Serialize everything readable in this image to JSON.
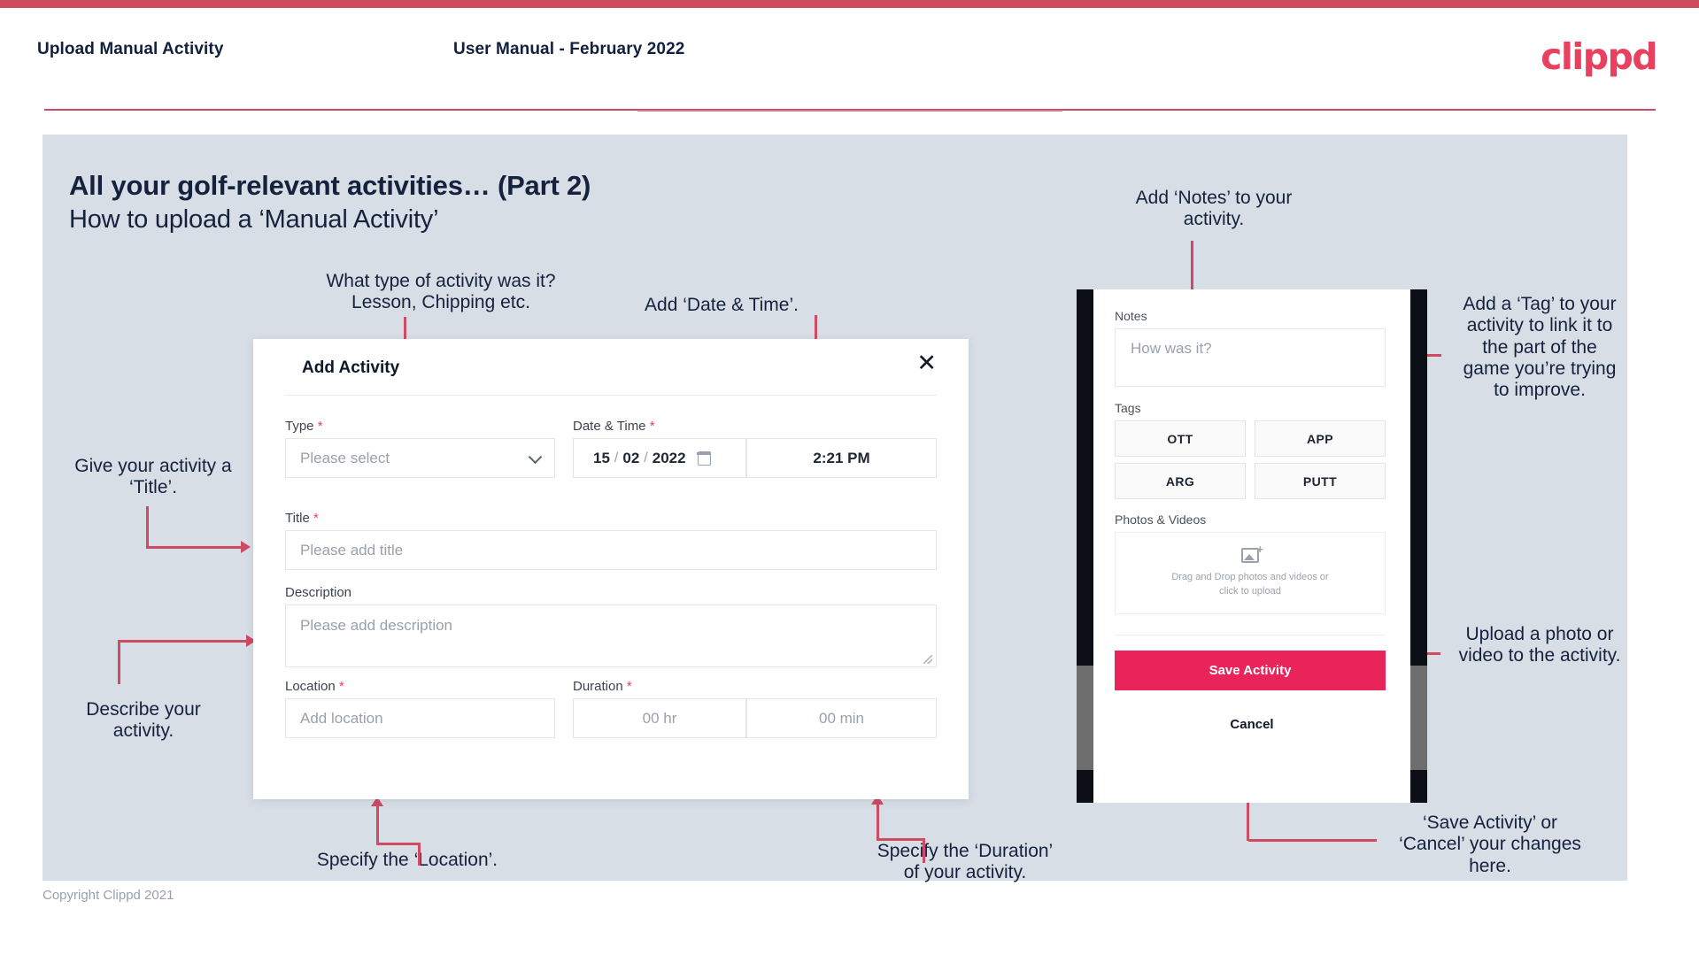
{
  "header": {
    "left_title": "Upload Manual Activity",
    "center_title": "User Manual - February 2022",
    "logo": "clippd"
  },
  "slide": {
    "title": "All your golf-relevant activities… (Part 2)",
    "subtitle": "How to upload a ‘Manual Activity’"
  },
  "annotations": {
    "type": "What type of activity was it?\nLesson, Chipping etc.",
    "datetime": "Add ‘Date & Time’.",
    "title": "Give your activity a\n‘Title’.",
    "description": "Describe your\nactivity.",
    "location": "Specify the ‘Location’.",
    "duration": "Specify the ‘Duration’\nof your activity.",
    "notes": "Add ‘Notes’ to your\nactivity.",
    "tags": "Add a ‘Tag’ to your\nactivity to link it to\nthe part of the\ngame you’re trying\nto improve.",
    "upload": "Upload a photo or\nvideo to the activity.",
    "save_cancel": "‘Save Activity’ or\n‘Cancel’ your changes\nhere."
  },
  "dialog": {
    "title": "Add Activity",
    "close_icon": "✕",
    "fields": {
      "type": {
        "label": "Type",
        "required": "*",
        "placeholder": "Please select"
      },
      "datetime": {
        "label": "Date & Time",
        "required": "*",
        "day": "15",
        "month": "02",
        "year": "2022",
        "separator": "/",
        "time": "2:21 PM"
      },
      "title": {
        "label": "Title",
        "required": "*",
        "placeholder": "Please add title"
      },
      "description": {
        "label": "Description",
        "required": "",
        "placeholder": "Please add description"
      },
      "location": {
        "label": "Location",
        "required": "*",
        "placeholder": "Add location"
      },
      "duration": {
        "label": "Duration",
        "required": "*",
        "hours_placeholder": "00 hr",
        "minutes_placeholder": "00 min"
      }
    }
  },
  "phone": {
    "notes": {
      "label": "Notes",
      "placeholder": "How was it?"
    },
    "tags": {
      "label": "Tags",
      "options": [
        "OTT",
        "APP",
        "ARG",
        "PUTT"
      ]
    },
    "photos": {
      "label": "Photos & Videos",
      "drop_text": "Drag and Drop photos and videos or\nclick to upload"
    },
    "save_label": "Save Activity",
    "cancel_label": "Cancel"
  },
  "footer": {
    "copyright": "Copyright Clippd 2021"
  },
  "colors": {
    "brand_pink": "#e8245a",
    "accent_line": "#cf4a63",
    "slide_bg": "#d7dee6",
    "text_dark": "#16223d"
  }
}
